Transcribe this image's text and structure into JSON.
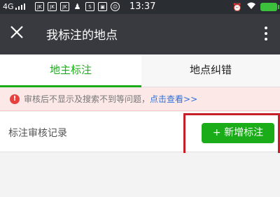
{
  "status_bar": {
    "network": "4G",
    "notifications": [
      "JK",
      "JK",
      "JK",
      "",
      "S",
      "",
      ""
    ],
    "time": "13:37"
  },
  "titlebar": {
    "title": "我标注的地点",
    "close_icon": "close-icon",
    "more_icon": "more-vertical-icon"
  },
  "tabs": [
    {
      "label": "地主标注",
      "active": true
    },
    {
      "label": "地点纠错",
      "active": false
    }
  ],
  "notice": {
    "text": "审核后不显示及搜索不到等问题，",
    "link": "点击查看>>"
  },
  "records": {
    "label": "标注审核记录",
    "add_button": "+ 新增标注"
  },
  "colors": {
    "accent": "#1aad19",
    "titlebar": "#393a3f",
    "link": "#2d6fd9",
    "highlight": "#c71e2a"
  }
}
